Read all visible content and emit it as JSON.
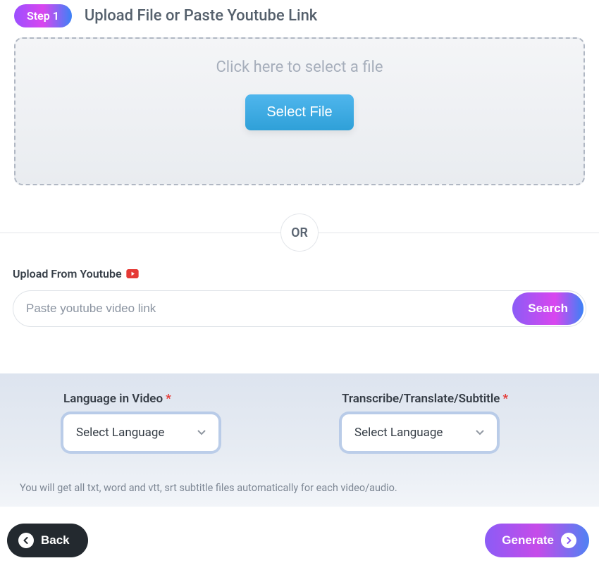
{
  "step": {
    "badge": "Step 1",
    "title": "Upload File or Paste Youtube Link"
  },
  "dropzone": {
    "text": "Click here to select a file",
    "button": "Select File"
  },
  "divider": {
    "or": "OR"
  },
  "youtube": {
    "label": "Upload From Youtube",
    "placeholder": "Paste youtube video link",
    "search": "Search"
  },
  "langPanel": {
    "col1": {
      "label": "Language in Video",
      "selected": "Select Language"
    },
    "col2": {
      "label": "Transcribe/Translate/Subtitle",
      "selected": "Select Language"
    },
    "note": "You will get all txt, word and vtt, srt subtitle files automatically for each video/audio."
  },
  "footer": {
    "back": "Back",
    "generate": "Generate"
  },
  "required": "*"
}
